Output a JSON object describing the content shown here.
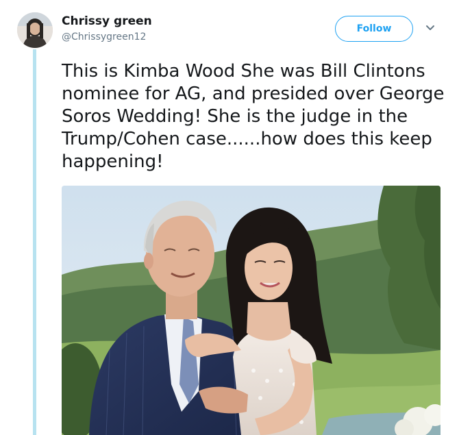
{
  "author": {
    "display_name": "Chrissy green",
    "handle": "@Chrissygreen12",
    "avatar_icon": "profile-avatar"
  },
  "header": {
    "follow_label": "Follow",
    "more_icon": "chevron-down-icon"
  },
  "tweet": {
    "text": "This is Kimba Wood She was Bill Clintons nominee for AG, and presided over George Soros Wedding! She is the judge in the Trump/Cohen case......how does this keep happening!"
  },
  "colors": {
    "accent": "#1da1f2",
    "thread_line": "#b7e2f0",
    "text": "#14171a",
    "secondary_text": "#657786"
  },
  "media": {
    "type": "photo",
    "subject_icon": "wedding-photo"
  }
}
